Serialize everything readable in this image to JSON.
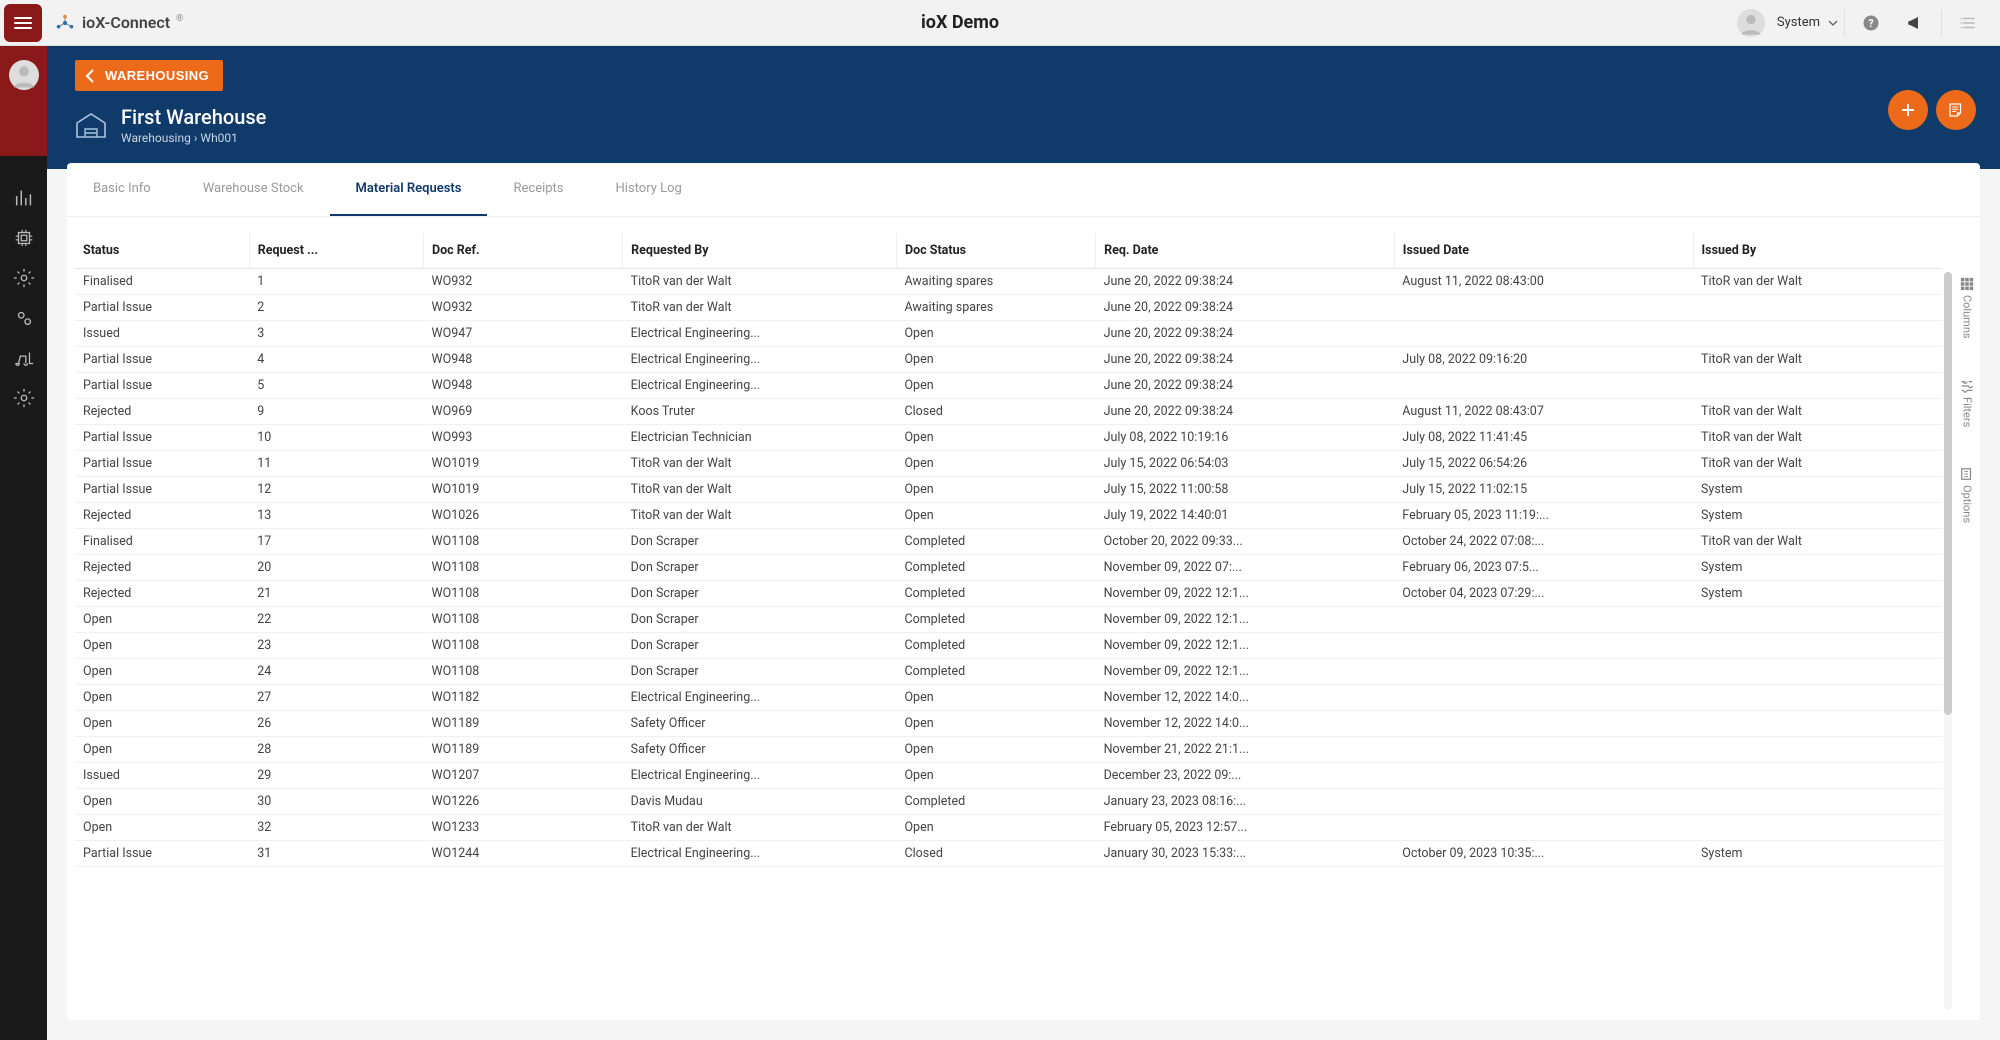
{
  "topbar": {
    "brand": "ioX-Connect",
    "center_title": "ioX Demo",
    "user_label": "System"
  },
  "hero": {
    "back_label": "WAREHOUSING",
    "title": "First Warehouse",
    "breadcrumb_parent": "Warehousing",
    "breadcrumb_sep": "›",
    "breadcrumb_code": "Wh001"
  },
  "tabs": [
    {
      "id": "tab-basic",
      "label": "Basic Info",
      "active": false
    },
    {
      "id": "tab-stock",
      "label": "Warehouse Stock",
      "active": false
    },
    {
      "id": "tab-matreq",
      "label": "Material Requests",
      "active": true
    },
    {
      "id": "tab-rec",
      "label": "Receipts",
      "active": false
    },
    {
      "id": "tab-hist",
      "label": "History Log",
      "active": false
    }
  ],
  "columns": [
    {
      "key": "status",
      "label": "Status",
      "w": "7%"
    },
    {
      "key": "request_no",
      "label": "Request ...",
      "w": "7%"
    },
    {
      "key": "doc_ref",
      "label": "Doc Ref.",
      "w": "8%"
    },
    {
      "key": "requested_by",
      "label": "Requested By",
      "w": "11%"
    },
    {
      "key": "doc_status",
      "label": "Doc Status",
      "w": "8%"
    },
    {
      "key": "req_date",
      "label": "Req. Date",
      "w": "12%"
    },
    {
      "key": "issued_date",
      "label": "Issued Date",
      "w": "12%"
    },
    {
      "key": "issued_by",
      "label": "Issued By",
      "w": "10%"
    }
  ],
  "rows": [
    {
      "status": "Finalised",
      "request_no": "1",
      "doc_ref": "WO932",
      "requested_by": "TitoR van der Walt",
      "doc_status": "Awaiting spares",
      "req_date": "June 20, 2022 09:38:24",
      "issued_date": "August 11, 2022 08:43:00",
      "issued_by": "TitoR van der Walt"
    },
    {
      "status": "Partial Issue",
      "request_no": "2",
      "doc_ref": "WO932",
      "requested_by": "TitoR van der Walt",
      "doc_status": "Awaiting spares",
      "req_date": "June 20, 2022 09:38:24",
      "issued_date": "",
      "issued_by": ""
    },
    {
      "status": "Issued",
      "request_no": "3",
      "doc_ref": "WO947",
      "requested_by": "Electrical Engineering...",
      "doc_status": "Open",
      "req_date": "June 20, 2022 09:38:24",
      "issued_date": "",
      "issued_by": ""
    },
    {
      "status": "Partial Issue",
      "request_no": "4",
      "doc_ref": "WO948",
      "requested_by": "Electrical Engineering...",
      "doc_status": "Open",
      "req_date": "June 20, 2022 09:38:24",
      "issued_date": "July 08, 2022 09:16:20",
      "issued_by": "TitoR van der Walt"
    },
    {
      "status": "Partial Issue",
      "request_no": "5",
      "doc_ref": "WO948",
      "requested_by": "Electrical Engineering...",
      "doc_status": "Open",
      "req_date": "June 20, 2022 09:38:24",
      "issued_date": "",
      "issued_by": ""
    },
    {
      "status": "Rejected",
      "request_no": "9",
      "doc_ref": "WO969",
      "requested_by": "Koos Truter",
      "doc_status": "Closed",
      "req_date": "June 20, 2022 09:38:24",
      "issued_date": "August 11, 2022 08:43:07",
      "issued_by": "TitoR van der Walt"
    },
    {
      "status": "Partial Issue",
      "request_no": "10",
      "doc_ref": "WO993",
      "requested_by": "Electrician Technician",
      "doc_status": "Open",
      "req_date": "July 08, 2022 10:19:16",
      "issued_date": "July 08, 2022 11:41:45",
      "issued_by": "TitoR van der Walt"
    },
    {
      "status": "Partial Issue",
      "request_no": "11",
      "doc_ref": "WO1019",
      "requested_by": "TitoR van der Walt",
      "doc_status": "Open",
      "req_date": "July 15, 2022 06:54:03",
      "issued_date": "July 15, 2022 06:54:26",
      "issued_by": "TitoR van der Walt"
    },
    {
      "status": "Partial Issue",
      "request_no": "12",
      "doc_ref": "WO1019",
      "requested_by": "TitoR van der Walt",
      "doc_status": "Open",
      "req_date": "July 15, 2022 11:00:58",
      "issued_date": "July 15, 2022 11:02:15",
      "issued_by": "System"
    },
    {
      "status": "Rejected",
      "request_no": "13",
      "doc_ref": "WO1026",
      "requested_by": "TitoR van der Walt",
      "doc_status": "Open",
      "req_date": "July 19, 2022 14:40:01",
      "issued_date": "February 05, 2023 11:19:...",
      "issued_by": "System"
    },
    {
      "status": "Finalised",
      "request_no": "17",
      "doc_ref": "WO1108",
      "requested_by": "Don Scraper",
      "doc_status": "Completed",
      "req_date": "October 20, 2022 09:33...",
      "issued_date": "October 24, 2022 07:08:...",
      "issued_by": "TitoR van der Walt"
    },
    {
      "status": "Rejected",
      "request_no": "20",
      "doc_ref": "WO1108",
      "requested_by": "Don Scraper",
      "doc_status": "Completed",
      "req_date": "November 09, 2022 07:...",
      "issued_date": "February 06, 2023 07:5...",
      "issued_by": "System"
    },
    {
      "status": "Rejected",
      "request_no": "21",
      "doc_ref": "WO1108",
      "requested_by": "Don Scraper",
      "doc_status": "Completed",
      "req_date": "November 09, 2022 12:1...",
      "issued_date": "October 04, 2023 07:29:...",
      "issued_by": "System"
    },
    {
      "status": "Open",
      "request_no": "22",
      "doc_ref": "WO1108",
      "requested_by": "Don Scraper",
      "doc_status": "Completed",
      "req_date": "November 09, 2022 12:1...",
      "issued_date": "",
      "issued_by": ""
    },
    {
      "status": "Open",
      "request_no": "23",
      "doc_ref": "WO1108",
      "requested_by": "Don Scraper",
      "doc_status": "Completed",
      "req_date": "November 09, 2022 12:1...",
      "issued_date": "",
      "issued_by": ""
    },
    {
      "status": "Open",
      "request_no": "24",
      "doc_ref": "WO1108",
      "requested_by": "Don Scraper",
      "doc_status": "Completed",
      "req_date": "November 09, 2022 12:1...",
      "issued_date": "",
      "issued_by": ""
    },
    {
      "status": "Open",
      "request_no": "27",
      "doc_ref": "WO1182",
      "requested_by": "Electrical Engineering...",
      "doc_status": "Open",
      "req_date": "November 12, 2022 14:0...",
      "issued_date": "",
      "issued_by": ""
    },
    {
      "status": "Open",
      "request_no": "26",
      "doc_ref": "WO1189",
      "requested_by": "Safety Officer",
      "doc_status": "Open",
      "req_date": "November 12, 2022 14:0...",
      "issued_date": "",
      "issued_by": ""
    },
    {
      "status": "Open",
      "request_no": "28",
      "doc_ref": "WO1189",
      "requested_by": "Safety Officer",
      "doc_status": "Open",
      "req_date": "November 21, 2022 21:1...",
      "issued_date": "",
      "issued_by": ""
    },
    {
      "status": "Issued",
      "request_no": "29",
      "doc_ref": "WO1207",
      "requested_by": "Electrical Engineering...",
      "doc_status": "Open",
      "req_date": "December 23, 2022 09:...",
      "issued_date": "",
      "issued_by": ""
    },
    {
      "status": "Open",
      "request_no": "30",
      "doc_ref": "WO1226",
      "requested_by": "Davis Mudau",
      "doc_status": "Completed",
      "req_date": "January 23, 2023 08:16:...",
      "issued_date": "",
      "issued_by": ""
    },
    {
      "status": "Open",
      "request_no": "32",
      "doc_ref": "WO1233",
      "requested_by": "TitoR van der Walt",
      "doc_status": "Open",
      "req_date": "February 05, 2023 12:57...",
      "issued_date": "",
      "issued_by": ""
    },
    {
      "status": "Partial Issue",
      "request_no": "31",
      "doc_ref": "WO1244",
      "requested_by": "Electrical Engineering...",
      "doc_status": "Closed",
      "req_date": "January 30, 2023 15:33:...",
      "issued_date": "October 09, 2023 10:35:...",
      "issued_by": "System"
    }
  ],
  "side_tools": {
    "columns": "Columns",
    "filters": "Filters",
    "options": "Options"
  }
}
